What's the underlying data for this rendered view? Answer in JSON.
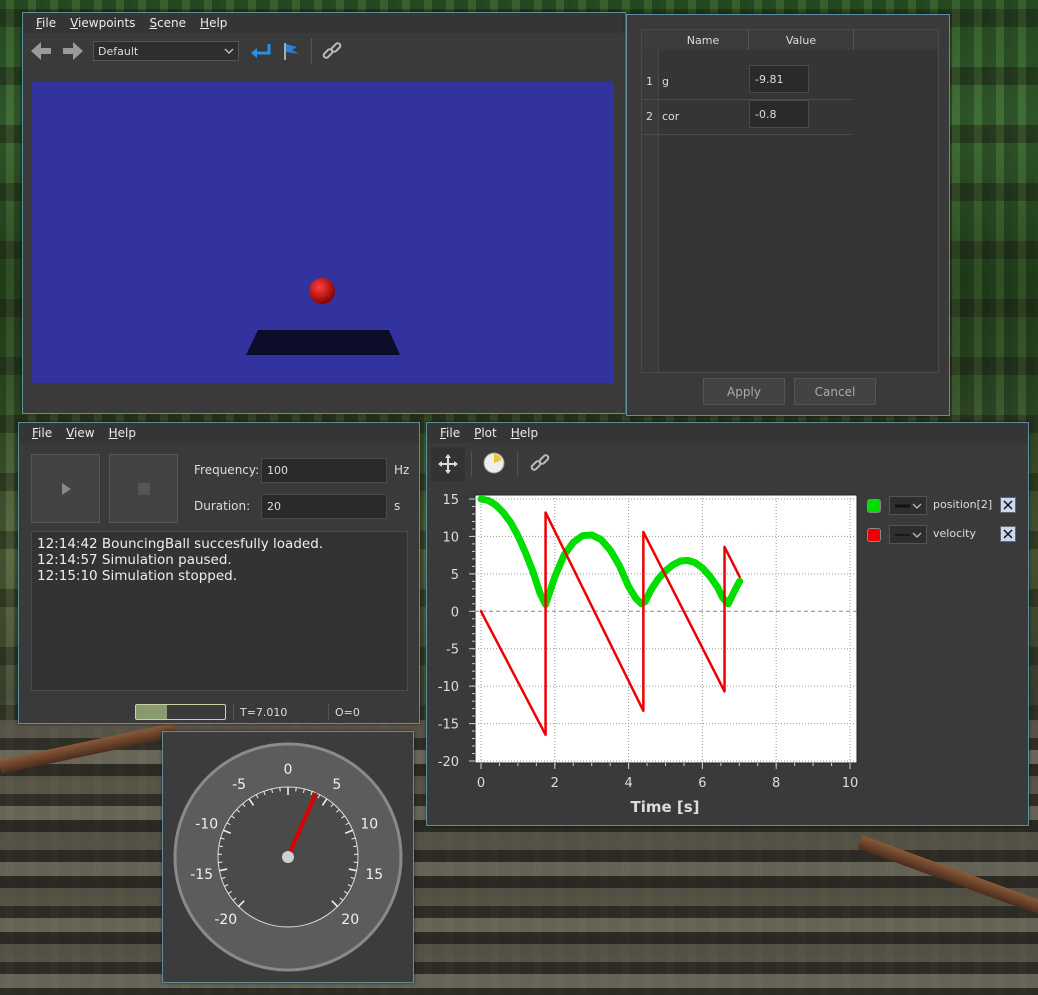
{
  "viewer": {
    "menu": [
      {
        "key": "F",
        "rest": "ile"
      },
      {
        "key": "V",
        "rest": "iewpoints"
      },
      {
        "key": "S",
        "rest": "cene"
      },
      {
        "key": "H",
        "rest": "elp"
      }
    ],
    "viewpoint_selected": "Default",
    "scene_color": "#3333a0",
    "ball_color": "#cc0000",
    "ground_color": "#0d0d2a"
  },
  "params": {
    "headers": [
      "Name",
      "Value"
    ],
    "rows": [
      {
        "index": "1",
        "name": "g",
        "value": "-9.81"
      },
      {
        "index": "2",
        "name": "cor",
        "value": "-0.8"
      }
    ],
    "apply_label": "Apply",
    "cancel_label": "Cancel"
  },
  "sim": {
    "menu": [
      {
        "key": "F",
        "rest": "ile"
      },
      {
        "key": "V",
        "rest": "iew"
      },
      {
        "key": "H",
        "rest": "elp"
      }
    ],
    "frequency_label": "Frequency:",
    "frequency_value": "100",
    "frequency_unit": "Hz",
    "duration_label": "Duration:",
    "duration_value": "20",
    "duration_unit": "s",
    "log": [
      "12:14:42 BouncingBall succesfully loaded.",
      "12:14:57 Simulation paused.",
      "12:15:10 Simulation stopped."
    ],
    "progress_fraction": 0.35,
    "status_time": "T=7.010",
    "status_overruns": "O=0"
  },
  "gauge": {
    "min": -20,
    "max": 20,
    "value": 3.5,
    "tick_labels": [
      "-20",
      "-15",
      "-10",
      "-5",
      "0",
      "5",
      "10",
      "15",
      "20"
    ],
    "needle_color": "#dd0000"
  },
  "plot": {
    "menu": [
      {
        "key": "F",
        "rest": "ile"
      },
      {
        "key": "P",
        "rest": "lot"
      },
      {
        "key": "H",
        "rest": "elp"
      }
    ],
    "legend": [
      {
        "name": "position[2]",
        "color": "#00dd00"
      },
      {
        "name": "velocity",
        "color": "#ee0000"
      }
    ]
  },
  "chart_data": {
    "type": "line",
    "xlabel": "Time [s]",
    "ylabel": "",
    "xlim": [
      0,
      10
    ],
    "ylim": [
      -20,
      15
    ],
    "x_ticks": [
      "0",
      "2",
      "4",
      "6",
      "8",
      "10"
    ],
    "y_ticks": [
      "15",
      "10",
      "5",
      "0",
      "-5",
      "-10",
      "-15",
      "-20"
    ],
    "grid": true,
    "series": [
      {
        "name": "position[2]",
        "color": "#00dd00",
        "x": [
          0,
          0.2,
          0.4,
          0.6,
          0.8,
          1.0,
          1.2,
          1.4,
          1.6,
          1.75,
          2.0,
          2.25,
          2.5,
          2.75,
          3.0,
          3.25,
          3.5,
          3.75,
          4.0,
          4.2,
          4.35,
          4.45,
          4.6,
          4.8,
          5.0,
          5.2,
          5.4,
          5.6,
          5.8,
          6.0,
          6.2,
          6.4,
          6.55,
          6.7,
          6.9,
          7.01
        ],
        "y": [
          15,
          14.8,
          14.2,
          13.2,
          11.9,
          10.1,
          7.9,
          5.4,
          2.4,
          0.9,
          4.6,
          7.5,
          9.2,
          10.1,
          10.2,
          9.6,
          8.2,
          6.1,
          3.3,
          1.7,
          1.0,
          1.3,
          2.8,
          4.3,
          5.4,
          6.2,
          6.7,
          6.8,
          6.5,
          5.8,
          4.7,
          3.3,
          1.8,
          1.0,
          3.0,
          4.0
        ]
      },
      {
        "name": "velocity",
        "color": "#ee0000",
        "x": [
          0,
          1.75,
          1.75,
          4.4,
          4.4,
          6.6,
          6.6,
          7.01
        ],
        "y": [
          0,
          -16.5,
          13.2,
          -13.3,
          10.6,
          -10.7,
          8.6,
          4.6
        ]
      }
    ]
  }
}
